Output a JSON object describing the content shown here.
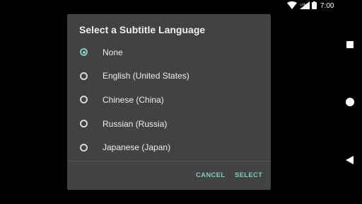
{
  "statusbar": {
    "time": "7:00",
    "signal_label": "LTE"
  },
  "dialog": {
    "title": "Select a Subtitle Language",
    "options": [
      {
        "label": "None",
        "checked": true
      },
      {
        "label": "English (United States)",
        "checked": false
      },
      {
        "label": "Chinese (China)",
        "checked": false
      },
      {
        "label": "Russian (Russia)",
        "checked": false
      },
      {
        "label": "Japanese (Japan)",
        "checked": false
      }
    ],
    "cancel_label": "CANCEL",
    "select_label": "SELECT"
  },
  "colors": {
    "accent": "#80cbc4",
    "dialog_bg": "#424242",
    "background": "#000000"
  },
  "icons": [
    "wifi-icon",
    "lte-signal-icon",
    "battery-icon",
    "nav-overview-icon",
    "nav-home-icon",
    "nav-back-icon"
  ]
}
